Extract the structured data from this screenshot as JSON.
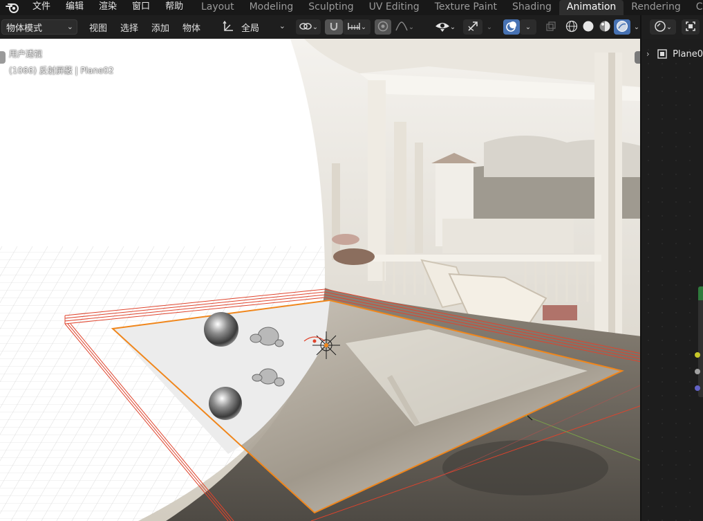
{
  "topbar": {
    "menus": [
      "文件",
      "编辑",
      "渲染",
      "窗口",
      "帮助"
    ],
    "workspaces": [
      "Layout",
      "Modeling",
      "Sculpting",
      "UV Editing",
      "Texture Paint",
      "Shading",
      "Animation",
      "Rendering",
      "Comp"
    ],
    "active_workspace": "Animation"
  },
  "header": {
    "mode": "物体模式",
    "menus": {
      "view": "视图",
      "select": "选择",
      "add": "添加",
      "object": "物体"
    },
    "orientation": "全局"
  },
  "viewport": {
    "view_name": "用户透视",
    "object_info": "(1066) 反射屏蔽 | Plane02"
  },
  "right_panel": {
    "node_title": "Plane0"
  },
  "colors": {
    "accent_blue": "#4772b3",
    "active_tab_bg": "#2e2e2e",
    "selection_orange": "#f0861b",
    "outline_red": "#e0432c",
    "socket_yellow": "#c7c729",
    "socket_grey": "#a1a1a1",
    "socket_purple": "#6363c7",
    "node_green": "#2f7a3c"
  },
  "icons": [
    "blender-logo-icon",
    "transform-orientation-icon",
    "link-icon",
    "snap-icon",
    "snap-increment-icon",
    "proportional-edit-icon",
    "falloff-icon",
    "visibility-icon",
    "gizmo-icon",
    "overlay-icon",
    "xray-icon",
    "wireframe-shading-icon",
    "solid-shading-icon",
    "material-shading-icon",
    "rendered-shading-icon",
    "node-editor-icon",
    "frame-icon",
    "expand-icon"
  ]
}
